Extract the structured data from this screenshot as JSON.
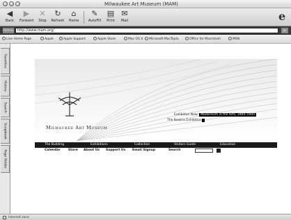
{
  "window": {
    "title": "Milwaukee Art Museum (MAM)"
  },
  "toolbar": {
    "buttons": [
      {
        "label": "Back",
        "icon": "back-arrow-icon"
      },
      {
        "label": "Forward",
        "icon": "forward-arrow-icon"
      },
      {
        "label": "Stop",
        "icon": "stop-icon"
      },
      {
        "label": "Refresh",
        "icon": "refresh-icon"
      },
      {
        "label": "Home",
        "icon": "home-icon"
      },
      {
        "label": "AutoFill",
        "icon": "autofill-icon"
      },
      {
        "label": "Print",
        "icon": "print-icon"
      },
      {
        "label": "Mail",
        "icon": "mail-icon"
      }
    ]
  },
  "address": {
    "label": "Address",
    "url": "http://www.mam.org/",
    "go_label": "go"
  },
  "favorites": [
    "Live Home Page",
    "Apple",
    "Apple Support",
    "Apple Store",
    "Mac OS X",
    "Microsoft MacTopia",
    "Office for Macintosh",
    "MSN"
  ],
  "sidebar": {
    "tabs": [
      "Favorites",
      "History",
      "Search",
      "Scrapbook",
      "Page Holder"
    ]
  },
  "page": {
    "museum_name": "Milwaukee Art Museum",
    "exhibition_1": {
      "prefix": "Exhibition Now:",
      "highlight": "Modernism in the Arts, 1900–1945"
    },
    "exhibition_2": {
      "prefix": "The Beatrix Exhibition",
      "highlight": ""
    },
    "nav": [
      "The Building",
      "Exhibitions",
      "Collection",
      "Visitors Guide",
      "Education"
    ],
    "subnav": [
      "Calendar",
      "Store",
      "About Us",
      "Support Us",
      "Email Signup",
      "Search"
    ]
  },
  "status": {
    "text": "Internet zone"
  },
  "colors": {
    "nav_bg": "#1a1a1a",
    "chrome": "#d6d6d6",
    "address_bar": "#3a3a3a"
  }
}
